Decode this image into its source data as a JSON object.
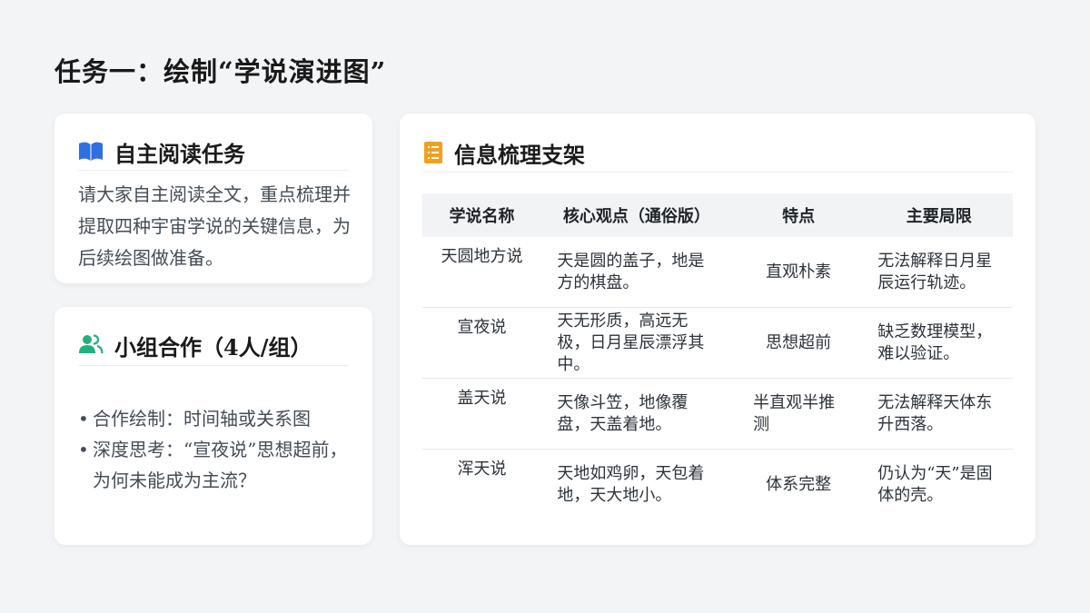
{
  "page": {
    "title": "任务一：绘制“学说演进图”"
  },
  "reading": {
    "icon": "book-icon",
    "title": "自主阅读任务",
    "body": "请大家自主阅读全文，重点梳理并提取四种宇宙学说的关键信息，为后续绘图做准备。"
  },
  "group": {
    "icon": "users-icon",
    "title": "小组合作（4人/组）",
    "items": [
      "合作绘制：时间轴或关系图",
      "深度思考：“宣夜说”思想超前，为何未能成为主流？"
    ]
  },
  "info": {
    "icon": "list-document-icon",
    "title": "信息梳理支架",
    "headers": [
      "学说名称",
      "核心观点（通俗版）",
      "特点",
      "主要局限"
    ],
    "rows": [
      [
        "天圆地方说",
        "天是圆的盖子，地是方的棋盘。",
        "直观朴素",
        "无法解释日月星辰运行轨迹。"
      ],
      [
        "宣夜说",
        "天无形质，高远无极，日月星辰漂浮其中。",
        "思想超前",
        "缺乏数理模型，难以验证。"
      ],
      [
        "盖天说",
        "天像斗笠，地像覆盘，天盖着地。",
        "半直观半推测",
        "无法解释天体东升西落。"
      ],
      [
        "浑天说",
        "天地如鸡卵，天包着地，天大地小。",
        "体系完整",
        "仍认为“天”是固体的壳。"
      ]
    ]
  },
  "colors": {
    "background": "#f3f4f6",
    "book_icon": "#2f6fe0",
    "users_icon": "#22b07d",
    "doc_icon": "#f0a020"
  }
}
